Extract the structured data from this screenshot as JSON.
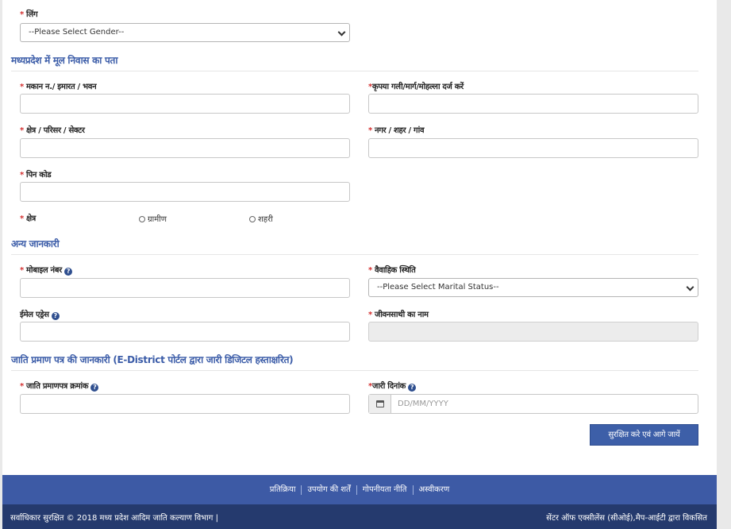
{
  "gender": {
    "label": "लिंग",
    "selected": "--Please Select Gender--"
  },
  "address_section": {
    "title": "मध्यप्रदेश में मूल निवास का पता",
    "house_label": "मकान न./ इमारत / भवन",
    "street_label": "कृपया गली/मार्ग/मोहल्ला दर्ज करें",
    "area_label": "क्षेत्र / परिसर / सेक्टर",
    "city_label": "नगर / शहर / गांव",
    "pin_label": "पिन कोड",
    "region_label": "क्षेत्र",
    "rural_label": "ग्रामीण",
    "urban_label": "शहरी"
  },
  "other_section": {
    "title": "अन्य जानकारी",
    "mobile_label": "मोबाइल नंबर",
    "marital_label": "वैवाहिक स्थिति",
    "marital_selected": "--Please Select Marital Status--",
    "email_label": "ईमेल एड्रेस",
    "spouse_label": "जीवनसाथी का नाम"
  },
  "caste_section": {
    "title": "जाति प्रमाण पत्र की जानकारी (E-District पोर्टल द्वारा जारी डिजिटल हस्ताक्षरित)",
    "cert_no_label": "जाति प्रमाणपत्र क्रमांक",
    "issue_date_label": "जारी दिनांक",
    "date_placeholder": "DD/MM/YYYY"
  },
  "save_button": "सुरक्षित करे एवं आगे जायें",
  "footer": {
    "links": [
      "प्रतिक्रिया",
      "उपयोग की शर्तें",
      "गोपनीयता नीति",
      "अस्वीकरण"
    ],
    "copyright": "सर्वाधिकार सुरक्षित © 2018 मध्य प्रदेश आदिम जाति कल्याण विभाग |",
    "developer": "सेंटर ऑफ एक्सीलेंस (सीओई),मैप-आईटी द्वारा विकसित"
  },
  "required_mark": "*",
  "help_icon": "question-circle-icon",
  "colors": {
    "accent": "#3d5aa5",
    "required": "#d32f2f",
    "footer_dark": "#253a6e"
  }
}
